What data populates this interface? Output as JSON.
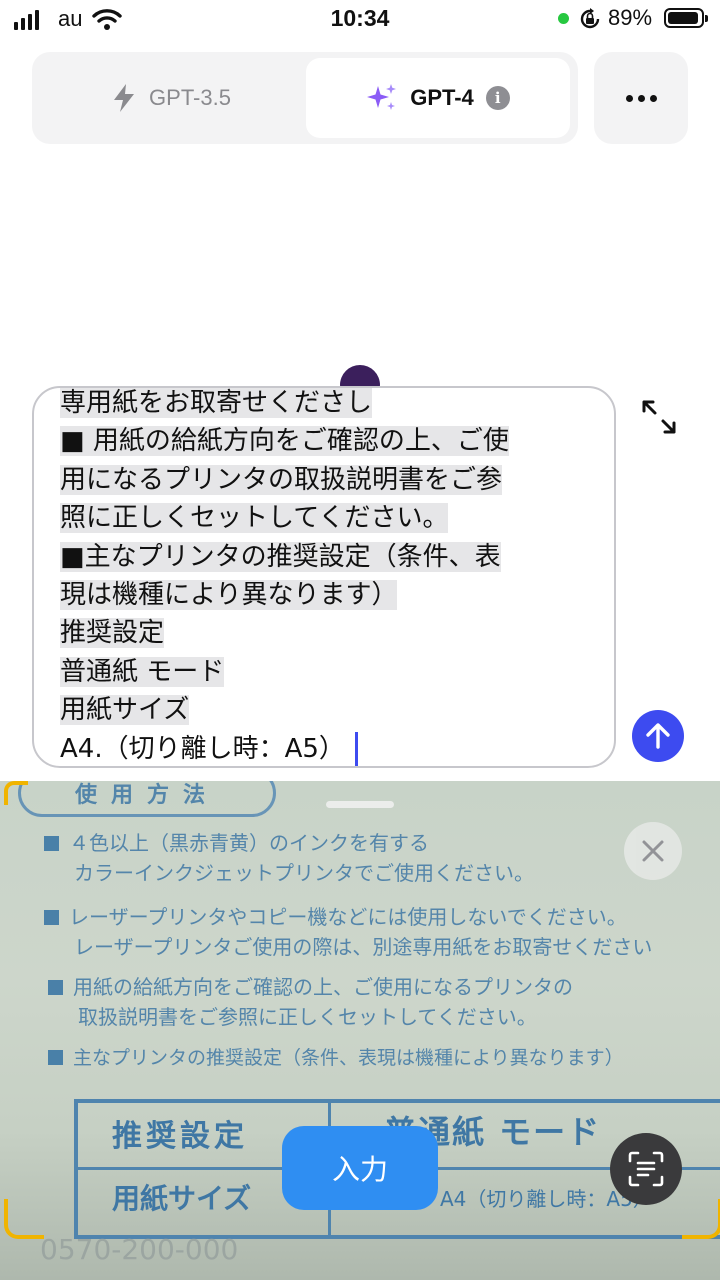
{
  "status_bar": {
    "carrier": "au",
    "time": "10:34",
    "battery": "89%"
  },
  "model_switch": {
    "option1": "GPT-3.5",
    "option2": "GPT-4",
    "selected": "GPT-4",
    "info_icon": "info-icon"
  },
  "composer": {
    "lines": [
      "専用紙をお取寄せくださし",
      "■ 用紙の給紙方向をご確認の上、ご使",
      "用になるプリンタの取扱説明書をご参",
      "照に正しくセットしてください。",
      "■主なプリンタの推奨設定（条件、表",
      "現は機種により異なります）",
      "推奨設定",
      "普通紙 モード",
      "用紙サイズ"
    ],
    "last_line": "A4.（切り離し時：A5）",
    "expand_icon": "expand-icon",
    "send_icon": "arrow-up-icon"
  },
  "camera": {
    "heading": "使用方法",
    "lines": [
      "４色以上（黒赤青黄）のインクを有する",
      "カラーインクジェットプリンタでご使用ください。",
      "レーザープリンタやコピー機などには使用しないでください。",
      "レーザープリンタご使用の際は、別途専用紙をお取寄せください",
      "用紙の給紙方向をご確認の上、ご使用になるプリンタの",
      "取扱説明書をご参照に正しくセットしてください。",
      "主なプリンタの推奨設定（条件、表現は機種により異なります）"
    ],
    "table": {
      "r1c1": "推奨設定",
      "r1c2": "普通紙 モード",
      "r2c1": "用紙サイズ",
      "r2c2": "A4（切り離し時：A5）"
    },
    "bottom_text": "0570-200-000",
    "input_button": "入力",
    "close_icon": "close-icon",
    "scan_icon": "text-scan-icon"
  },
  "colors": {
    "accent": "#3d4bf0",
    "input_button": "#2f8ef2",
    "gpt4_sparkle": "#8b5cf6",
    "document_ink": "#4a7fa8"
  }
}
